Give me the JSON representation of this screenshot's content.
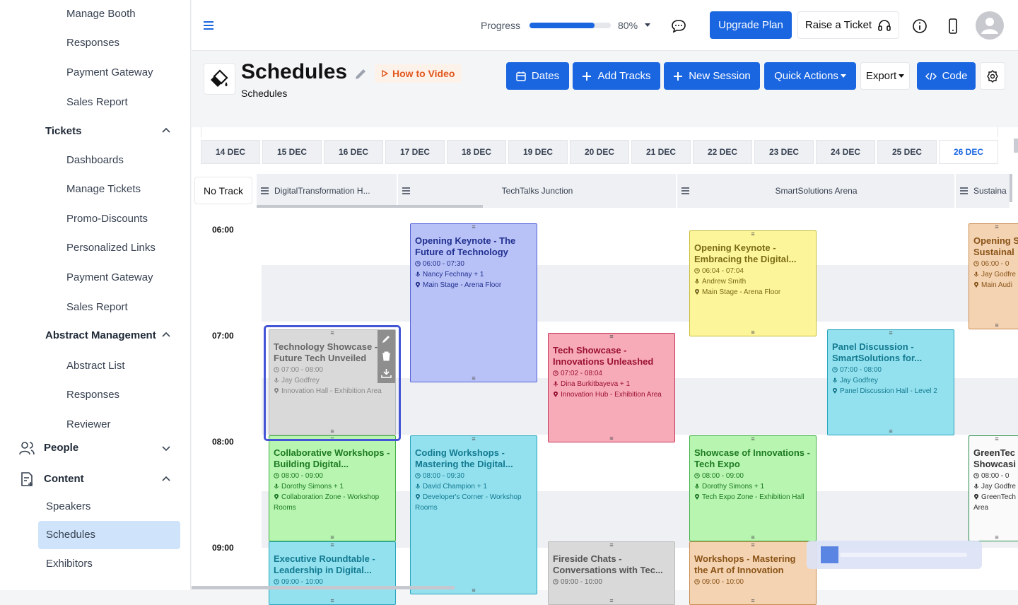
{
  "sidebar": {
    "top_items": [
      {
        "label": "Manage Booth"
      },
      {
        "label": "Responses"
      },
      {
        "label": "Payment Gateway"
      },
      {
        "label": "Sales Report"
      }
    ],
    "tickets_group": "Tickets",
    "tickets_items": [
      {
        "label": "Dashboards"
      },
      {
        "label": "Manage Tickets"
      },
      {
        "label": "Promo-Discounts"
      },
      {
        "label": "Personalized Links"
      },
      {
        "label": "Payment Gateway"
      },
      {
        "label": "Sales Report"
      }
    ],
    "abstract_group": "Abstract Management",
    "abstract_items": [
      {
        "label": "Abstract List"
      },
      {
        "label": "Responses"
      },
      {
        "label": "Reviewer"
      }
    ],
    "people": "People",
    "content": "Content",
    "content_items": [
      {
        "label": "Speakers"
      },
      {
        "label": "Schedules"
      },
      {
        "label": "Exhibitors"
      }
    ]
  },
  "topbar": {
    "progress_label": "Progress",
    "progress_value": 0.8,
    "progress_text": "80%",
    "upgrade": "Upgrade Plan",
    "raise": "Raise a Ticket"
  },
  "header": {
    "title": "Schedules",
    "subtitle": "Schedules",
    "how_to": "How to Video",
    "dates": "Dates",
    "add_tracks": "Add Tracks",
    "new_session": "New Session",
    "quick_actions": "Quick Actions",
    "export": "Export",
    "code": "Code"
  },
  "dates": [
    "14 DEC",
    "15 DEC",
    "16 DEC",
    "17 DEC",
    "18 DEC",
    "19 DEC",
    "20 DEC",
    "21 DEC",
    "22 DEC",
    "23 DEC",
    "24 DEC",
    "25 DEC",
    "26 DEC"
  ],
  "no_track": "No Track",
  "tracks": [
    "DigitalTransformation H...",
    "TechTalks Junction",
    "SmartSolutions Arena",
    "Sustaina"
  ],
  "times": [
    "06:00",
    "07:00",
    "08:00",
    "09:00"
  ],
  "events": [
    {
      "title": "Technology Showcase - Future Tech Unveiled",
      "time": "07:00 - 08:00",
      "speaker": "Jay Godfrey",
      "location": "Innovation Hall - Exhibition Area"
    },
    {
      "title": "Opening Keynote - The Future of Technology",
      "time": "06:00 - 07:30",
      "speaker": "Nancy Fechnay + 1",
      "location": "Main Stage - Arena Floor"
    },
    {
      "title": "Opening Keynote - Embracing the Digital...",
      "time": "06:04 - 07:04",
      "speaker": "Andrew Smith",
      "location": "Main Stage - Arena Floor"
    },
    {
      "title": "Opening S Sustainal",
      "time": "06:00 - 0",
      "speaker": "Jay Godfre",
      "location": "Main Audi"
    },
    {
      "title": "Tech Showcase - Innovations Unleashed",
      "time": "07:02 - 08:04",
      "speaker": "Dina Burkitbayeva + 1",
      "location": "Innovation Hub - Exhibition Area"
    },
    {
      "title": "Panel Discussion - SmartSolutions for...",
      "time": "07:00 - 08:00",
      "speaker": "Jay Godfrey",
      "location": "Panel Discussion Hall - Level 2"
    },
    {
      "title": "Collaborative Workshops - Building Digital...",
      "time": "08:00 - 09:00",
      "speaker": "Dorothy Simons + 1",
      "location": "Collaboration Zone - Workshop Rooms"
    },
    {
      "title": "Coding Workshops - Mastering the Digital...",
      "time": "08:00 - 09:30",
      "speaker": "David Champion + 1",
      "location": "Developer's Corner - Workshop Rooms"
    },
    {
      "title": "Showcase of Innovations - Tech Expo",
      "time": "08:00 - 09:00",
      "speaker": "Dorothy Simons + 1",
      "location": "Tech Expo Zone - Exhibition Hall"
    },
    {
      "title": "GreenTec Showcasi",
      "time": "08:00 - 0",
      "speaker": "Jay Godfre",
      "location": "GreenTech Area"
    },
    {
      "title": "Executive Roundtable - Leadership in Digital...",
      "time": "09:00 - 10:00",
      "speaker": "",
      "location": ""
    },
    {
      "title": "Fireside Chats - Conversations with Tec...",
      "time": "09:00 - 10:00",
      "speaker": "",
      "location": ""
    },
    {
      "title": "Workshops - Mastering the Art of Innovation",
      "time": "09:00 - 10:00",
      "speaker": "",
      "location": ""
    }
  ],
  "colors": {
    "accent": "#1a66e0",
    "selected_date": "#1a66e0"
  }
}
